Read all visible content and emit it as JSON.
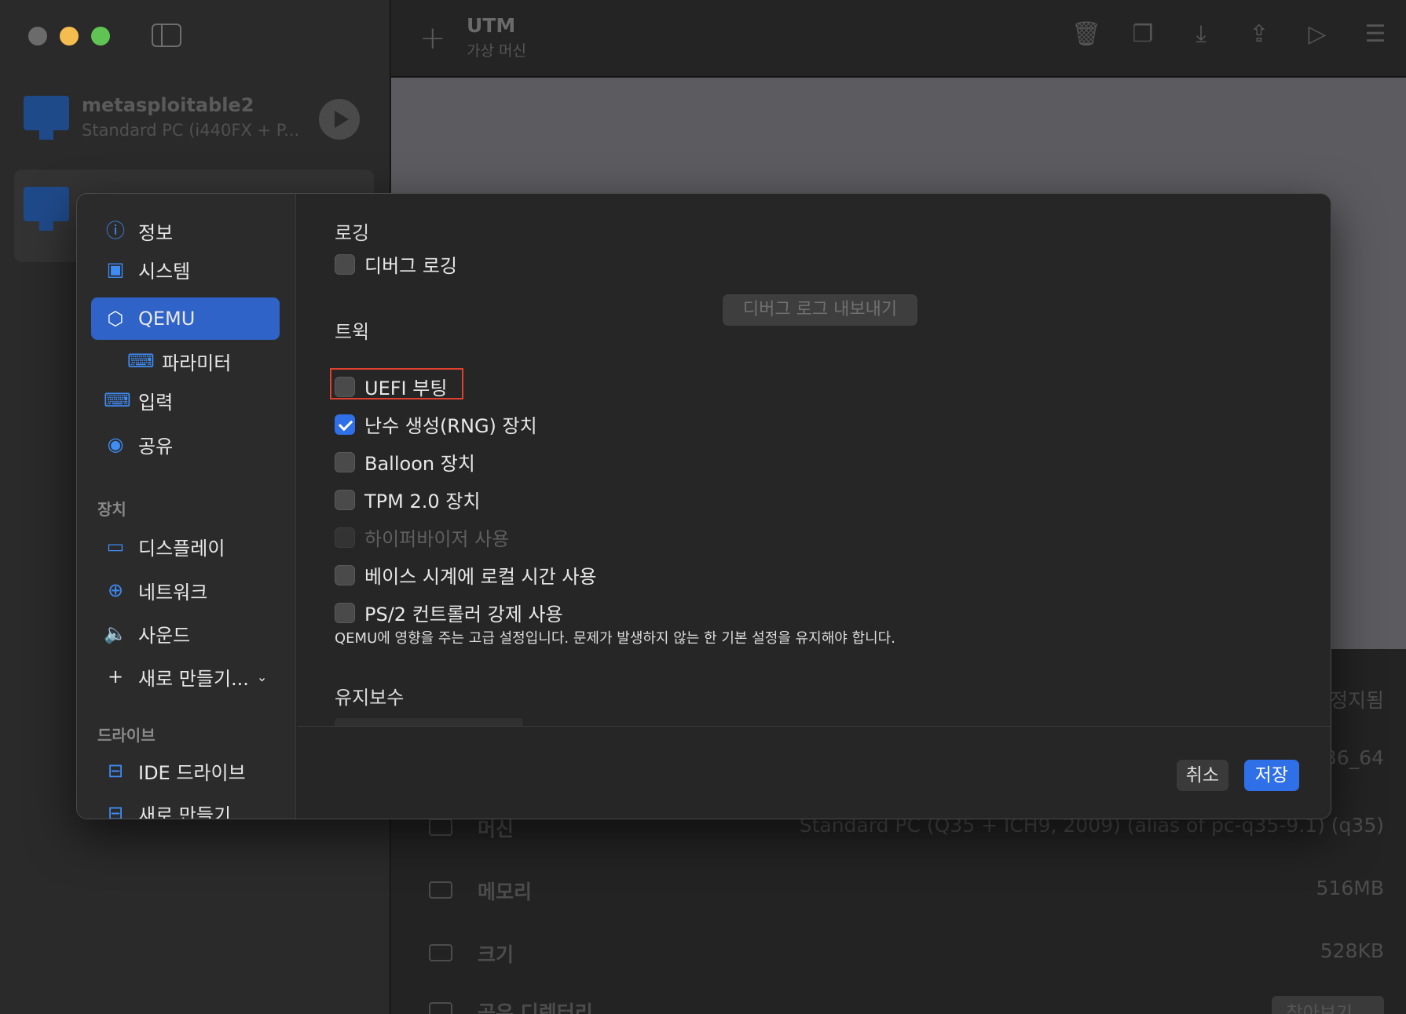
{
  "window": {
    "app_title": "UTM",
    "app_subtitle": "가상 머신"
  },
  "vm_list": [
    {
      "name": "metasploitable2",
      "description": "Standard PC (i440FX + P..."
    }
  ],
  "toolbar": {
    "add": "+",
    "icons": [
      "trash-icon",
      "clone-icon",
      "download-icon",
      "share-icon",
      "play-icon",
      "settings-sliders-icon"
    ]
  },
  "details": {
    "status_partial": "정지됨",
    "arch_partial": "36_64",
    "machine_label": "머신",
    "machine_value": "Standard PC (Q35 + ICH9, 2009) (alias of pc-q35-9.1) (q35)",
    "memory_label": "메모리",
    "memory_value": "516MB",
    "size_label": "크기",
    "size_value": "528KB",
    "shared_label": "공유 디렉터리",
    "shared_button": "찾아보기..."
  },
  "dialog": {
    "nav": {
      "info": "정보",
      "system": "시스템",
      "qemu": "QEMU",
      "parameters": "파라미터",
      "input": "입력",
      "sharing": "공유",
      "devices_header": "장치",
      "display": "디스플레이",
      "network": "네트워크",
      "sound": "사운드",
      "new_device": "새로 만들기...",
      "drives_header": "드라이브",
      "ide_drive": "IDE 드라이브",
      "new_drive": "새로 만들기..."
    },
    "logging": {
      "title": "로깅",
      "debug_logging": "디버그 로깅",
      "debug_logging_checked": false,
      "export_button": "디버그 로그 내보내기"
    },
    "tweaks": {
      "title": "트윅",
      "options": [
        {
          "label": "UEFI 부팅",
          "checked": false,
          "disabled": false
        },
        {
          "label": "난수 생성(RNG) 장치",
          "checked": true,
          "disabled": false
        },
        {
          "label": "Balloon 장치",
          "checked": false,
          "disabled": false
        },
        {
          "label": "TPM 2.0 장치",
          "checked": false,
          "disabled": false
        },
        {
          "label": "하이퍼바이저 사용",
          "checked": false,
          "disabled": true
        },
        {
          "label": "베이스 시계에 로컬 시간 사용",
          "checked": false,
          "disabled": false
        },
        {
          "label": "PS/2 컨트롤러 강제 사용",
          "checked": false,
          "disabled": false
        }
      ],
      "note": "QEMU에 영향을 주는 고급 설정입니다. 문제가 발생하지 않는 한 기본 설정을 유지해야 합니다."
    },
    "maintenance": {
      "title": "유지보수"
    },
    "footer": {
      "cancel": "취소",
      "save": "저장"
    },
    "colors": {
      "accent": "#2f6fe8",
      "highlight_outline": "#e0402e"
    }
  }
}
